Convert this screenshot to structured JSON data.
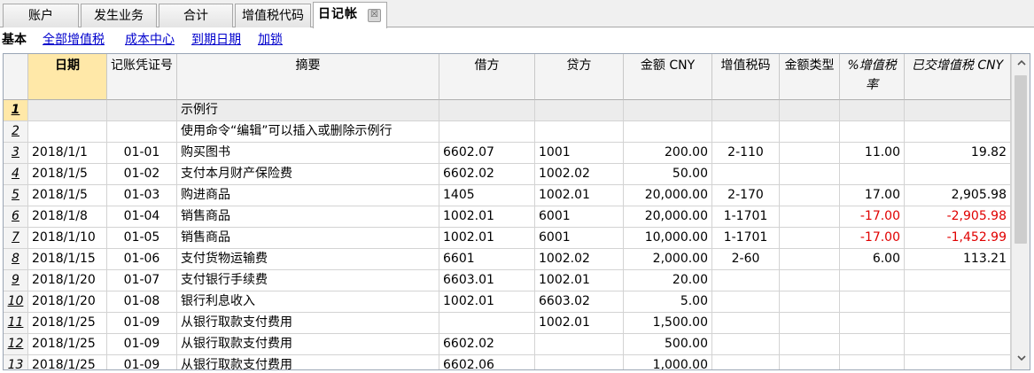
{
  "tabs": [
    {
      "label": "账户"
    },
    {
      "label": "发生业务"
    },
    {
      "label": "合计"
    },
    {
      "label": "增值税代码"
    },
    {
      "label": "日记帐",
      "active": true
    }
  ],
  "tab_close_glyph": "☒",
  "subnav": {
    "current": "基本",
    "links": [
      "全部增值税",
      "成本中心",
      "到期日期",
      "加锁"
    ]
  },
  "columns": [
    "日期",
    "记账凭证号",
    "摘要",
    "借方",
    "贷方",
    "金额 CNY",
    "增值税码",
    "金额类型",
    "%增值税率",
    "已交增值税 CNY"
  ],
  "rows": [
    {
      "n": "1",
      "date": "",
      "doc": "",
      "desc": "示例行",
      "debit": "",
      "credit": "",
      "amount": "",
      "vat_code": "",
      "amount_type": "",
      "vat_pct": "",
      "vat_posted": ""
    },
    {
      "n": "2",
      "date": "",
      "doc": "",
      "desc": "使用命令“编辑”可以插入或删除示例行",
      "debit": "",
      "credit": "",
      "amount": "",
      "vat_code": "",
      "amount_type": "",
      "vat_pct": "",
      "vat_posted": ""
    },
    {
      "n": "3",
      "date": "2018/1/1",
      "doc": "01-01",
      "desc": "购买图书",
      "debit": "6602.07",
      "credit": "1001",
      "amount": "200.00",
      "vat_code": "2-110",
      "amount_type": "",
      "vat_pct": "11.00",
      "vat_posted": "19.82"
    },
    {
      "n": "4",
      "date": "2018/1/5",
      "doc": "01-02",
      "desc": "支付本月财产保险费",
      "debit": "6602.02",
      "credit": "1002.02",
      "amount": "50.00",
      "vat_code": "",
      "amount_type": "",
      "vat_pct": "",
      "vat_posted": ""
    },
    {
      "n": "5",
      "date": "2018/1/5",
      "doc": "01-03",
      "desc": "购进商品",
      "debit": "1405",
      "credit": "1002.01",
      "amount": "20,000.00",
      "vat_code": "2-170",
      "amount_type": "",
      "vat_pct": "17.00",
      "vat_posted": "2,905.98"
    },
    {
      "n": "6",
      "date": "2018/1/8",
      "doc": "01-04",
      "desc": "销售商品",
      "debit": "1002.01",
      "credit": "6001",
      "amount": "20,000.00",
      "vat_code": "1-1701",
      "amount_type": "",
      "vat_pct": "-17.00",
      "vat_posted": "-2,905.98"
    },
    {
      "n": "7",
      "date": "2018/1/10",
      "doc": "01-05",
      "desc": "销售商品",
      "debit": "1002.01",
      "credit": "6001",
      "amount": "10,000.00",
      "vat_code": "1-1701",
      "amount_type": "",
      "vat_pct": "-17.00",
      "vat_posted": "-1,452.99"
    },
    {
      "n": "8",
      "date": "2018/1/15",
      "doc": "01-06",
      "desc": "支付货物运输费",
      "debit": "6601",
      "credit": "1002.02",
      "amount": "2,000.00",
      "vat_code": "2-60",
      "amount_type": "",
      "vat_pct": "6.00",
      "vat_posted": "113.21"
    },
    {
      "n": "9",
      "date": "2018/1/20",
      "doc": "01-07",
      "desc": "支付银行手续费",
      "debit": "6603.01",
      "credit": "1002.01",
      "amount": "20.00",
      "vat_code": "",
      "amount_type": "",
      "vat_pct": "",
      "vat_posted": ""
    },
    {
      "n": "10",
      "date": "2018/1/20",
      "doc": "01-08",
      "desc": "银行利息收入",
      "debit": "1002.01",
      "credit": "6603.02",
      "amount": "5.00",
      "vat_code": "",
      "amount_type": "",
      "vat_pct": "",
      "vat_posted": ""
    },
    {
      "n": "11",
      "date": "2018/1/25",
      "doc": "01-09",
      "desc": "从银行取款支付费用",
      "debit": "",
      "credit": "1002.01",
      "amount": "1,500.00",
      "vat_code": "",
      "amount_type": "",
      "vat_pct": "",
      "vat_posted": ""
    },
    {
      "n": "12",
      "date": "2018/1/25",
      "doc": "01-09",
      "desc": "从银行取款支付费用",
      "debit": "6602.02",
      "credit": "",
      "amount": "500.00",
      "vat_code": "",
      "amount_type": "",
      "vat_pct": "",
      "vat_posted": ""
    },
    {
      "n": "13",
      "date": "2018/1/25",
      "doc": "01-09",
      "desc": "从银行取款支付费用",
      "debit": "6602.06",
      "credit": "",
      "amount": "1,000.00",
      "vat_code": "",
      "amount_type": "",
      "vat_pct": "",
      "vat_posted": ""
    }
  ],
  "colors": {
    "selected_header": "#ffe8a8",
    "negative": "#e00000",
    "link": "#0000cc"
  },
  "scrollbar": {
    "up_icon": "chevron-up-icon",
    "down_icon": "chevron-down-icon"
  }
}
